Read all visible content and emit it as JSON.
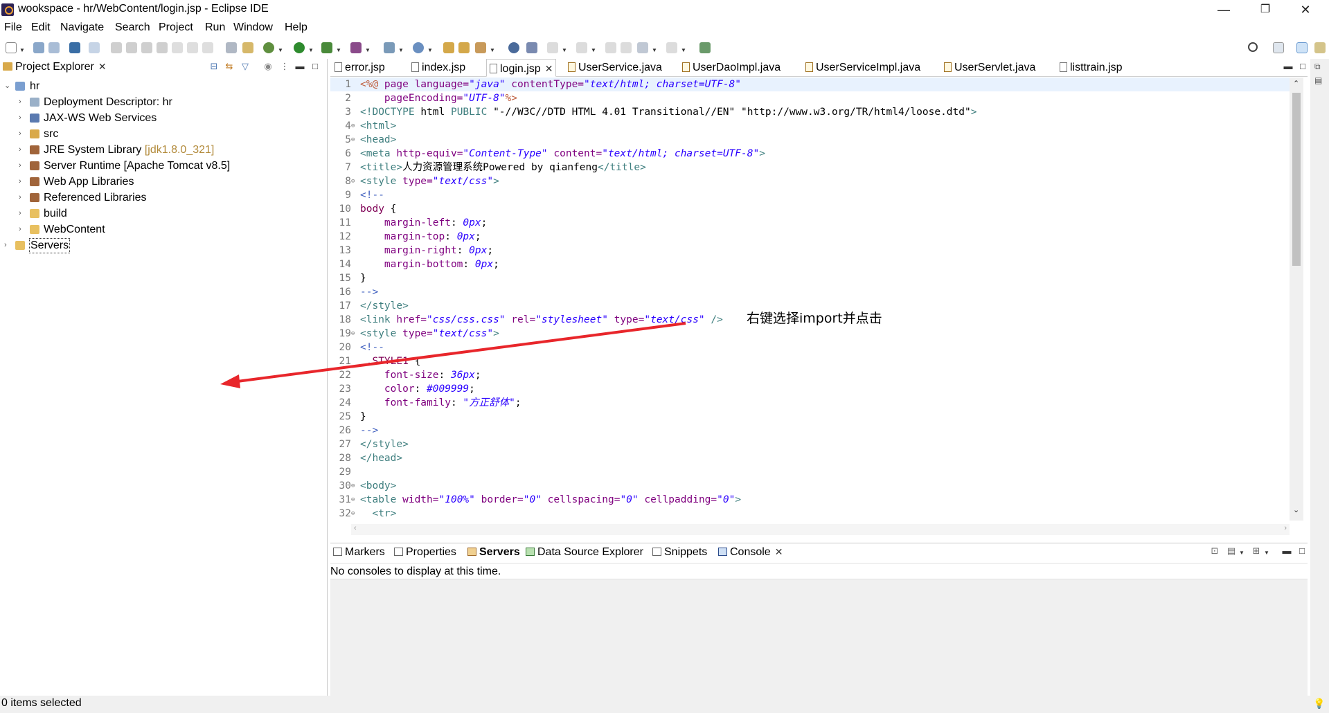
{
  "window": {
    "title": "wookspace - hr/WebContent/login.jsp - Eclipse IDE",
    "minimize": "—",
    "restore": "❐",
    "close": "✕"
  },
  "menu": [
    "File",
    "Edit",
    "Navigate",
    "Search",
    "Project",
    "Run",
    "Window",
    "Help"
  ],
  "project_explorer": {
    "tab_label": "Project Explorer",
    "tree": [
      {
        "label": "hr",
        "decor": "",
        "expanded": true,
        "icon": "web-project-icon"
      },
      {
        "label": "Deployment Descriptor: hr",
        "decor": "",
        "icon": "deployment-descriptor-icon"
      },
      {
        "label": "JAX-WS Web Services",
        "decor": "",
        "icon": "web-services-icon"
      },
      {
        "label": "src",
        "decor": "",
        "icon": "source-folder-icon"
      },
      {
        "label": "JRE System Library",
        "decor": "[jdk1.8.0_321]",
        "icon": "library-icon"
      },
      {
        "label": "Server Runtime [Apache Tomcat v8.5]",
        "decor": "",
        "icon": "library-icon"
      },
      {
        "label": "Web App Libraries",
        "decor": "",
        "icon": "library-icon"
      },
      {
        "label": "Referenced Libraries",
        "decor": "",
        "icon": "library-icon"
      },
      {
        "label": "build",
        "decor": "",
        "icon": "folder-icon"
      },
      {
        "label": "WebContent",
        "decor": "",
        "icon": "folder-icon"
      },
      {
        "label": "Servers",
        "decor": "",
        "icon": "folder-icon"
      }
    ]
  },
  "editor": {
    "tabs": [
      {
        "label": "error.jsp",
        "type": "jsp"
      },
      {
        "label": "index.jsp",
        "type": "jsp"
      },
      {
        "label": "login.jsp",
        "type": "jsp",
        "active": true
      },
      {
        "label": "UserService.java",
        "type": "java"
      },
      {
        "label": "UserDaoImpl.java",
        "type": "java"
      },
      {
        "label": "UserServiceImpl.java",
        "type": "java"
      },
      {
        "label": "UserServlet.java",
        "type": "java"
      },
      {
        "label": "listtrain.jsp",
        "type": "jsp"
      }
    ],
    "lines": [
      {
        "n": "1",
        "fold": "",
        "segs": [
          [
            "jsp",
            "<%@ "
          ],
          [
            "at",
            "page "
          ],
          [
            "at",
            "language="
          ],
          [
            "sv",
            "\"java\""
          ],
          [
            "tx",
            " "
          ],
          [
            "at",
            "contentType="
          ],
          [
            "sv",
            "\"text/html; charset=UTF-8\""
          ]
        ]
      },
      {
        "n": "2",
        "fold": "",
        "segs": [
          [
            "tx",
            "    "
          ],
          [
            "at",
            "pageEncoding="
          ],
          [
            "sv",
            "\"UTF-8\""
          ],
          [
            "jsp",
            "%>"
          ]
        ]
      },
      {
        "n": "3",
        "fold": "",
        "segs": [
          [
            "tg",
            "<!DOCTYPE "
          ],
          [
            "tx",
            "html "
          ],
          [
            "tg",
            "PUBLIC "
          ],
          [
            "sv2",
            "\"-//W3C//DTD HTML 4.01 Transitional//EN\" \"http://www.w3.org/TR/html4/loose.dtd\""
          ],
          [
            "tg",
            ">"
          ]
        ]
      },
      {
        "n": "4",
        "fold": "⊖",
        "segs": [
          [
            "tg",
            "<html>"
          ]
        ]
      },
      {
        "n": "5",
        "fold": "⊖",
        "segs": [
          [
            "tg",
            "<head>"
          ]
        ]
      },
      {
        "n": "6",
        "fold": "",
        "segs": [
          [
            "tg",
            "<meta "
          ],
          [
            "at",
            "http-equiv="
          ],
          [
            "sv",
            "\"Content-Type\""
          ],
          [
            "tx",
            " "
          ],
          [
            "at",
            "content="
          ],
          [
            "sv",
            "\"text/html; charset=UTF-8\""
          ],
          [
            "tg",
            ">"
          ]
        ]
      },
      {
        "n": "7",
        "fold": "",
        "segs": [
          [
            "tg",
            "<title>"
          ],
          [
            "tx",
            "人力资源管理系统Powered by qianfeng"
          ],
          [
            "tg",
            "</title>"
          ]
        ]
      },
      {
        "n": "8",
        "fold": "⊖",
        "segs": [
          [
            "tg",
            "<style "
          ],
          [
            "at",
            "type="
          ],
          [
            "sv",
            "\"text/css\""
          ],
          [
            "tg",
            ">"
          ]
        ]
      },
      {
        "n": "9",
        "fold": "",
        "segs": [
          [
            "cm",
            "<!--"
          ]
        ]
      },
      {
        "n": "10",
        "fold": "",
        "segs": [
          [
            "prop",
            "body"
          ],
          [
            "tx",
            " {"
          ]
        ]
      },
      {
        "n": "11",
        "fold": "",
        "segs": [
          [
            "tx",
            "    "
          ],
          [
            "prop2",
            "margin-left"
          ],
          [
            "tx",
            ": "
          ],
          [
            "pv",
            "0px"
          ],
          [
            "tx",
            ";"
          ]
        ]
      },
      {
        "n": "12",
        "fold": "",
        "segs": [
          [
            "tx",
            "    "
          ],
          [
            "prop2",
            "margin-top"
          ],
          [
            "tx",
            ": "
          ],
          [
            "pv",
            "0px"
          ],
          [
            "tx",
            ";"
          ]
        ]
      },
      {
        "n": "13",
        "fold": "",
        "segs": [
          [
            "tx",
            "    "
          ],
          [
            "prop2",
            "margin-right"
          ],
          [
            "tx",
            ": "
          ],
          [
            "pv",
            "0px"
          ],
          [
            "tx",
            ";"
          ]
        ]
      },
      {
        "n": "14",
        "fold": "",
        "segs": [
          [
            "tx",
            "    "
          ],
          [
            "prop2",
            "margin-bottom"
          ],
          [
            "tx",
            ": "
          ],
          [
            "pv",
            "0px"
          ],
          [
            "tx",
            ";"
          ]
        ]
      },
      {
        "n": "15",
        "fold": "",
        "segs": [
          [
            "tx",
            "}"
          ]
        ]
      },
      {
        "n": "16",
        "fold": "",
        "segs": [
          [
            "cm",
            "-->"
          ]
        ]
      },
      {
        "n": "17",
        "fold": "",
        "segs": [
          [
            "tg",
            "</style>"
          ]
        ]
      },
      {
        "n": "18",
        "fold": "",
        "segs": [
          [
            "tg",
            "<link "
          ],
          [
            "at",
            "href="
          ],
          [
            "sv",
            "\"css/css.css\""
          ],
          [
            "tx",
            " "
          ],
          [
            "at",
            "rel="
          ],
          [
            "sv",
            "\"stylesheet\""
          ],
          [
            "tx",
            " "
          ],
          [
            "at",
            "type="
          ],
          [
            "sv",
            "\"text/css\""
          ],
          [
            "tx",
            " "
          ],
          [
            "tg",
            "/>"
          ]
        ]
      },
      {
        "n": "19",
        "fold": "⊖",
        "segs": [
          [
            "tg",
            "<style "
          ],
          [
            "at",
            "type="
          ],
          [
            "sv",
            "\"text/css\""
          ],
          [
            "tg",
            ">"
          ]
        ]
      },
      {
        "n": "20",
        "fold": "",
        "segs": [
          [
            "cm",
            "<!--"
          ]
        ]
      },
      {
        "n": "21",
        "fold": "",
        "segs": [
          [
            "prop",
            " .STYLE1"
          ],
          [
            "tx",
            " {"
          ]
        ]
      },
      {
        "n": "22",
        "fold": "",
        "segs": [
          [
            "tx",
            "    "
          ],
          [
            "prop2",
            "font-size"
          ],
          [
            "tx",
            ": "
          ],
          [
            "pv",
            "36px"
          ],
          [
            "tx",
            ";"
          ]
        ]
      },
      {
        "n": "23",
        "fold": "",
        "segs": [
          [
            "tx",
            "    "
          ],
          [
            "prop2",
            "color"
          ],
          [
            "tx",
            ": "
          ],
          [
            "pv",
            "#009999"
          ],
          [
            "tx",
            ";"
          ]
        ]
      },
      {
        "n": "24",
        "fold": "",
        "segs": [
          [
            "tx",
            "    "
          ],
          [
            "prop2",
            "font-family"
          ],
          [
            "tx",
            ": "
          ],
          [
            "pv",
            "\"方正舒体\""
          ],
          [
            "tx",
            ";"
          ]
        ]
      },
      {
        "n": "25",
        "fold": "",
        "segs": [
          [
            "tx",
            "}"
          ]
        ]
      },
      {
        "n": "26",
        "fold": "",
        "segs": [
          [
            "cm",
            "-->"
          ]
        ]
      },
      {
        "n": "27",
        "fold": "",
        "segs": [
          [
            "tg",
            "</style>"
          ]
        ]
      },
      {
        "n": "28",
        "fold": "",
        "segs": [
          [
            "tg",
            "</head>"
          ]
        ]
      },
      {
        "n": "29",
        "fold": "",
        "segs": []
      },
      {
        "n": "30",
        "fold": "⊖",
        "segs": [
          [
            "tg",
            "<body>"
          ]
        ]
      },
      {
        "n": "31",
        "fold": "⊖",
        "segs": [
          [
            "tg",
            "<table "
          ],
          [
            "at",
            "width="
          ],
          [
            "sv",
            "\"100%\""
          ],
          [
            "tx",
            " "
          ],
          [
            "at",
            "border="
          ],
          [
            "sv",
            "\"0\""
          ],
          [
            "tx",
            " "
          ],
          [
            "at",
            "cellspacing="
          ],
          [
            "sv",
            "\"0\""
          ],
          [
            "tx",
            " "
          ],
          [
            "at",
            "cellpadding="
          ],
          [
            "sv",
            "\"0\""
          ],
          [
            "tg",
            ">"
          ]
        ]
      },
      {
        "n": "32",
        "fold": "⊖",
        "segs": [
          [
            "tx",
            "  "
          ],
          [
            "tg",
            "<tr>"
          ]
        ]
      }
    ]
  },
  "bottom_panel": {
    "tabs": [
      {
        "label": "Markers",
        "bold": false,
        "icon": "markers-icon"
      },
      {
        "label": "Properties",
        "bold": false,
        "icon": "properties-icon"
      },
      {
        "label": "Servers",
        "bold": true,
        "icon": "servers-icon"
      },
      {
        "label": "Data Source Explorer",
        "bold": false,
        "icon": "data-source-icon"
      },
      {
        "label": "Snippets",
        "bold": false,
        "icon": "snippets-icon"
      },
      {
        "label": "Console",
        "bold": false,
        "icon": "console-icon",
        "active": true
      }
    ],
    "console_message": "No consoles to display at this time."
  },
  "status_bar": {
    "text": "0 items selected"
  },
  "annotation": {
    "text": "右键选择import并点击",
    "arrow_color": "#e8262b"
  },
  "colors": {
    "accent": "#2a00ff",
    "tag": "#3f7f7f",
    "attr": "#7f007f",
    "arrow": "#e8262b"
  }
}
